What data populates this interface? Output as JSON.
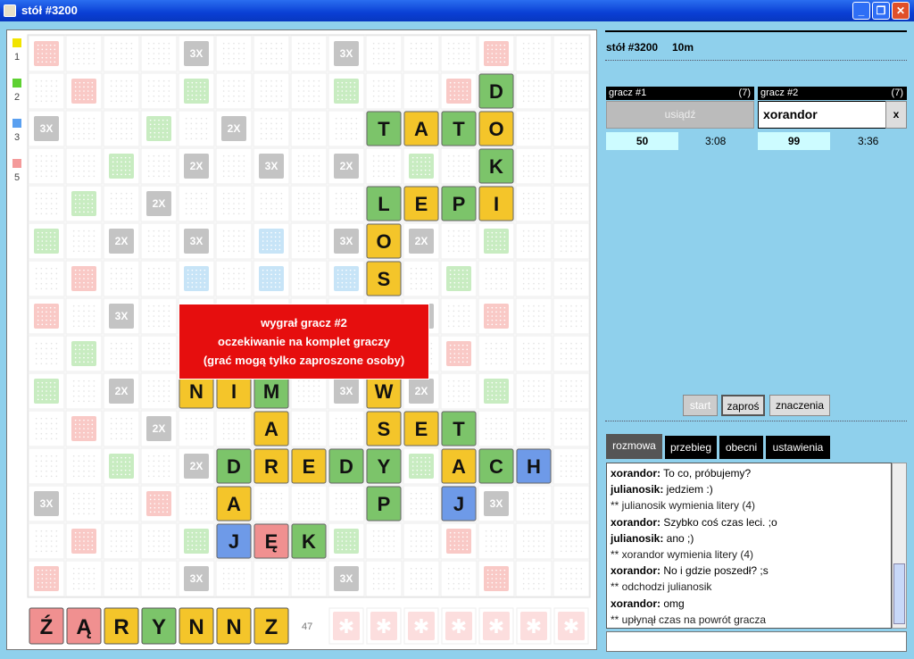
{
  "window": {
    "title": "stół #3200",
    "buttons": [
      "_",
      "❐",
      "✕"
    ]
  },
  "legend": [
    {
      "value": "1",
      "color": "#f1e400"
    },
    {
      "value": "2",
      "color": "#5ed132"
    },
    {
      "value": "3",
      "color": "#5aa0f0"
    },
    {
      "value": "5",
      "color": "#f49a9a"
    }
  ],
  "board": {
    "premium": [
      "S...3...3...S",
      ".S..S...S..S.",
      "3..S.2...S..3",
      "..S.2.3.2.S..",
      ".S.2.....2.S.",
      "S.2.3.B.3.2.S",
      ".S..B.B.B..S.",
      "S.3...3...3.S",
      ".S..B.B.B..S.",
      "S.2.3.B.3.2.S",
      ".S.2.....2.S.",
      "..S.2.3.2.S..",
      "3..S.2...S..3",
      ".S..S...S..S.",
      "S...3...3...S"
    ],
    "tiles": [
      {
        "r": 1,
        "c": 12,
        "l": "D",
        "v": 2
      },
      {
        "r": 2,
        "c": 9,
        "l": "T",
        "v": 2
      },
      {
        "r": 2,
        "c": 10,
        "l": "A",
        "v": 1
      },
      {
        "r": 2,
        "c": 11,
        "l": "T",
        "v": 2
      },
      {
        "r": 2,
        "c": 12,
        "l": "O",
        "v": 1
      },
      {
        "r": 3,
        "c": 12,
        "l": "K",
        "v": 2
      },
      {
        "r": 4,
        "c": 9,
        "l": "L",
        "v": 2
      },
      {
        "r": 4,
        "c": 10,
        "l": "E",
        "v": 1
      },
      {
        "r": 4,
        "c": 11,
        "l": "P",
        "v": 2
      },
      {
        "r": 4,
        "c": 12,
        "l": "I",
        "v": 1
      },
      {
        "r": 5,
        "c": 9,
        "l": "O",
        "v": 1
      },
      {
        "r": 6,
        "c": 9,
        "l": "S",
        "v": 1
      },
      {
        "r": 9,
        "c": 4,
        "l": "N",
        "v": 1
      },
      {
        "r": 9,
        "c": 5,
        "l": "I",
        "v": 1
      },
      {
        "r": 9,
        "c": 6,
        "l": "M",
        "v": 2
      },
      {
        "r": 9,
        "c": 9,
        "l": "W",
        "v": 1
      },
      {
        "r": 10,
        "c": 6,
        "l": "A",
        "v": 1
      },
      {
        "r": 10,
        "c": 9,
        "l": "S",
        "v": 1
      },
      {
        "r": 10,
        "c": 10,
        "l": "E",
        "v": 1
      },
      {
        "r": 10,
        "c": 11,
        "l": "T",
        "v": 2
      },
      {
        "r": 11,
        "c": 5,
        "l": "D",
        "v": 2
      },
      {
        "r": 11,
        "c": 6,
        "l": "R",
        "v": 1
      },
      {
        "r": 11,
        "c": 7,
        "l": "E",
        "v": 1
      },
      {
        "r": 11,
        "c": 8,
        "l": "D",
        "v": 2
      },
      {
        "r": 11,
        "c": 9,
        "l": "Y",
        "v": 2
      },
      {
        "r": 11,
        "c": 11,
        "l": "A",
        "v": 1
      },
      {
        "r": 11,
        "c": 12,
        "l": "C",
        "v": 2
      },
      {
        "r": 11,
        "c": 13,
        "l": "H",
        "v": 3
      },
      {
        "r": 12,
        "c": 5,
        "l": "A",
        "v": 1
      },
      {
        "r": 12,
        "c": 9,
        "l": "P",
        "v": 2
      },
      {
        "r": 12,
        "c": 11,
        "l": "J",
        "v": 3
      },
      {
        "r": 13,
        "c": 5,
        "l": "J",
        "v": 3
      },
      {
        "r": 13,
        "c": 6,
        "l": "Ę",
        "v": 5
      },
      {
        "r": 13,
        "c": 7,
        "l": "K",
        "v": 2
      }
    ]
  },
  "rack": [
    {
      "l": "Ź",
      "v": 5
    },
    {
      "l": "Ą",
      "v": 5
    },
    {
      "l": "R",
      "v": 1
    },
    {
      "l": "Y",
      "v": 2
    },
    {
      "l": "N",
      "v": 1
    },
    {
      "l": "N",
      "v": 1
    },
    {
      "l": "Z",
      "v": 1
    }
  ],
  "bag_count": "47",
  "overlay": {
    "line1": "wygrał gracz #2",
    "line2": "oczekiwanie na komplet graczy",
    "line3": "(grać mogą tylko zaproszone osoby)"
  },
  "table": {
    "title": "stół #3200",
    "time": "10m"
  },
  "players": [
    {
      "label": "gracz #1",
      "tiles": "(7)",
      "sit_label": "usiądź",
      "score": "50",
      "time": "3:08"
    },
    {
      "label": "gracz #2",
      "tiles": "(7)",
      "name": "xorandor",
      "close": "x",
      "score": "99",
      "time": "3:36"
    }
  ],
  "controls": {
    "start": "start",
    "invite": "zaproś",
    "markings": "znaczenia"
  },
  "tabs": [
    "rozmowa",
    "przebieg",
    "obecni",
    "ustawienia"
  ],
  "chat": [
    {
      "who": "xorandor:",
      "text": "To co, próbujemy?"
    },
    {
      "who": "julianosik:",
      "text": "jedziem :)"
    },
    {
      "sys": "** julianosik wymienia litery (4)"
    },
    {
      "who": "xorandor:",
      "text": "Szybko coś czas leci. ;o"
    },
    {
      "who": "julianosik:",
      "text": "ano ;)"
    },
    {
      "sys": "** xorandor wymienia litery (4)"
    },
    {
      "who": "xorandor:",
      "text": "No i gdzie poszedł? ;s"
    },
    {
      "sys": "** odchodzi julianosik"
    },
    {
      "who": "xorandor:",
      "text": "omg"
    },
    {
      "sys": "** upłynął czas na powrót gracza"
    }
  ],
  "colors": {
    "yellow": "#f4c52a",
    "green": "#7cc46a",
    "blue": "#6e9ae8",
    "red": "#f09090",
    "bg": "#8fd0ec"
  }
}
